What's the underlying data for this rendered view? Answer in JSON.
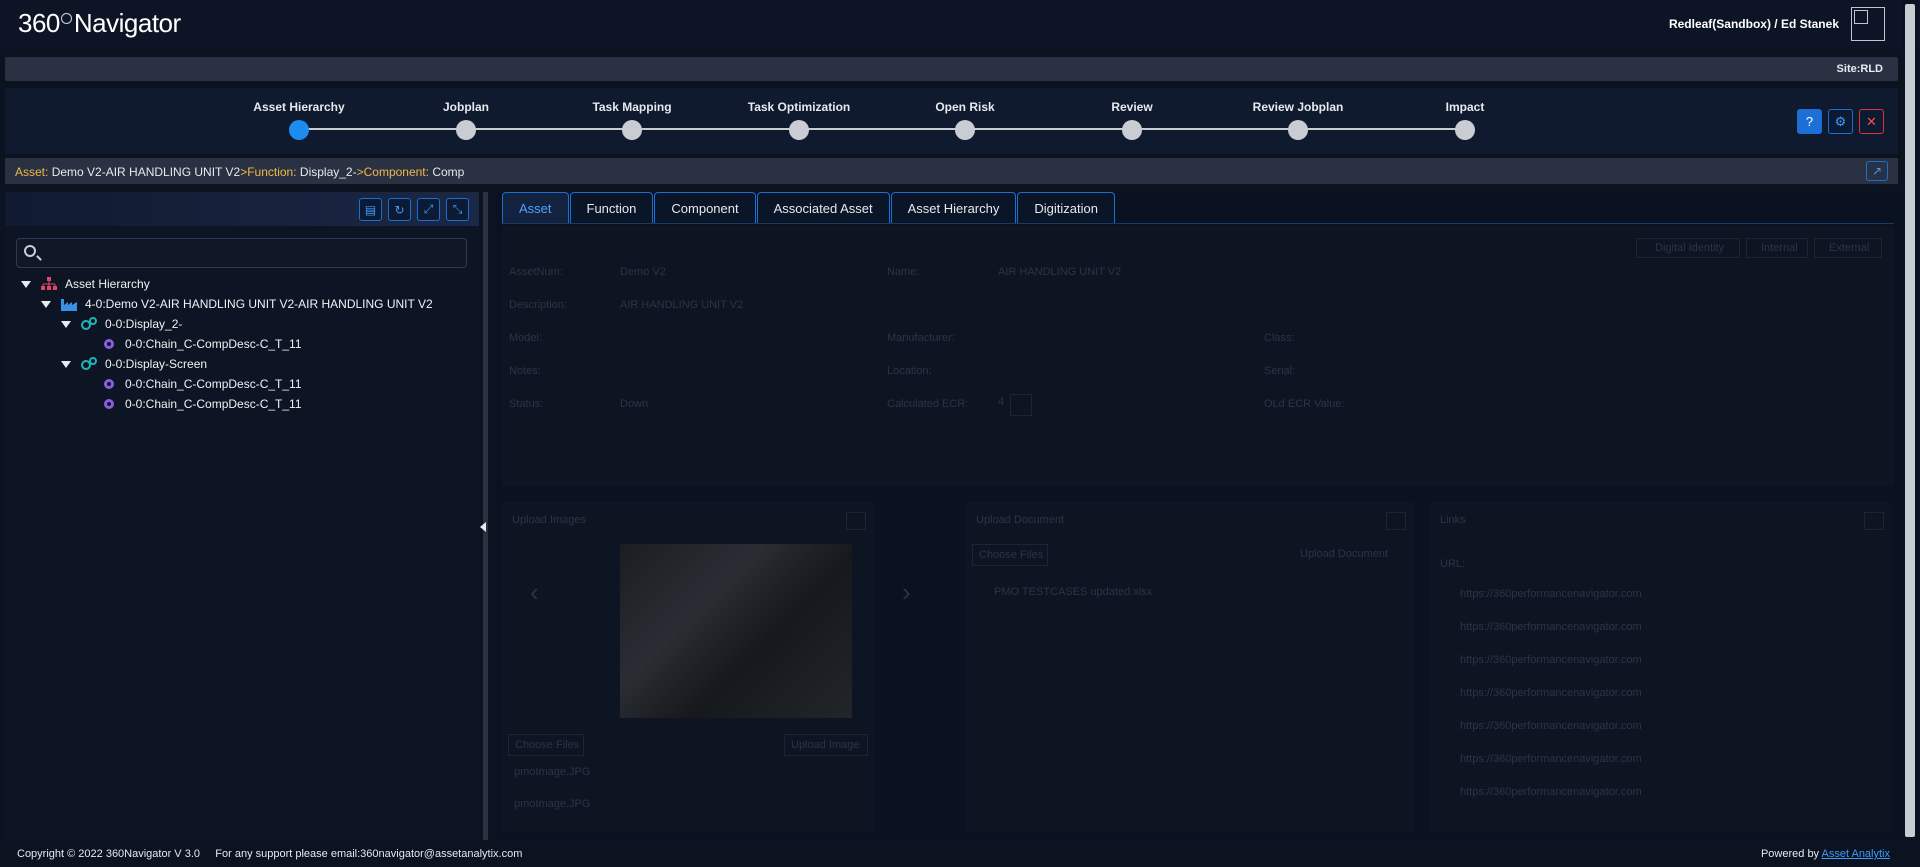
{
  "app": {
    "logo_num": "360",
    "logo_text": "Navigator"
  },
  "user": {
    "label": "Redleaf(Sandbox) / Ed Stanek"
  },
  "site": {
    "label": "Site:RLD"
  },
  "steps": [
    {
      "label": "Asset Hierarchy",
      "active": true
    },
    {
      "label": "Jobplan",
      "active": false
    },
    {
      "label": "Task Mapping",
      "active": false
    },
    {
      "label": "Task Optimization",
      "active": false
    },
    {
      "label": "Open Risk",
      "active": false
    },
    {
      "label": "Review",
      "active": false
    },
    {
      "label": "Review Jobplan",
      "active": false
    },
    {
      "label": "Impact",
      "active": false
    }
  ],
  "header_icons": {
    "help": "?",
    "settings": "⚙",
    "close": "✕"
  },
  "breadcrumb": {
    "asset_key": "Asset:",
    "asset_val": " Demo V2-AIR HANDLING UNIT V2",
    "function_key": ">Function:",
    "function_val": " Display_2-",
    "component_key": ">Component:",
    "component_val": " Comp"
  },
  "tree": {
    "root": "Asset Hierarchy",
    "asset": "4-0:Demo V2-AIR HANDLING UNIT V2-AIR HANDLING UNIT V2",
    "func1": "0-0:Display_2-",
    "func1_comp1": "0-0:Chain_C-CompDesc-C_T_11",
    "func2": "0-0:Display-Screen",
    "func2_comp1": "0-0:Chain_C-CompDesc-C_T_11",
    "func2_comp2": "0-0:Chain_C-CompDesc-C_T_11"
  },
  "tabs": [
    "Asset",
    "Function",
    "Component",
    "Associated Asset",
    "Asset Hierarchy",
    "Digitization"
  ],
  "form": {
    "assetnum_label": "AssetNum:",
    "assetnum_val": "Demo V2",
    "name_label": "Name:",
    "name_val": "AIR HANDLING UNIT V2",
    "desc_label": "Description:",
    "desc_val": "AIR HANDLING UNIT V2",
    "model_label": "Model:",
    "manufacturer_label": "Manufacturer:",
    "class_label": "Class:",
    "notes_label": "Notes:",
    "location_label": "Location:",
    "serial_label": "Serial:",
    "status_label": "Status:",
    "status_val": "Down",
    "ecr_label": "Calculated ECR:",
    "ecr_val": "4",
    "old_ecr_label": "OLd ECR Value:",
    "btn_digital": "Digital Identity",
    "btn_internal": "Internal",
    "btn_external": "External"
  },
  "cards": {
    "images_title": "Upload Images",
    "choose_files": "Choose Files",
    "upload_image": "Upload Image",
    "img_files": [
      "pmoImage.JPG",
      "pmoImage.JPG"
    ],
    "doc_title": "Upload Document",
    "doc_choose": "Choose Files",
    "upload_doc": "Upload Document",
    "doc_file": "PMO TESTCASES updated.xlsx",
    "links_title": "Links",
    "url_label": "URL:",
    "links": [
      "https://360performancenavigator.com",
      "https://360performancenavigator.com",
      "https://360performancenavigator.com",
      "https://360performancenavigator.com",
      "https://360performancenavigator.com",
      "https://360performancenavigator.com",
      "https://360performancenavigator.com"
    ]
  },
  "footer": {
    "left": "Copyright © 2022 360Navigator V 3.0     For any support please email:360navigator@assetanalytix.com",
    "powered": "Powered by ",
    "powered_link": "Asset Analytix"
  },
  "colors": {
    "accent": "#1d8cf0",
    "breadcrumb_key": "#f2b84b",
    "close": "#ff4a4a"
  }
}
